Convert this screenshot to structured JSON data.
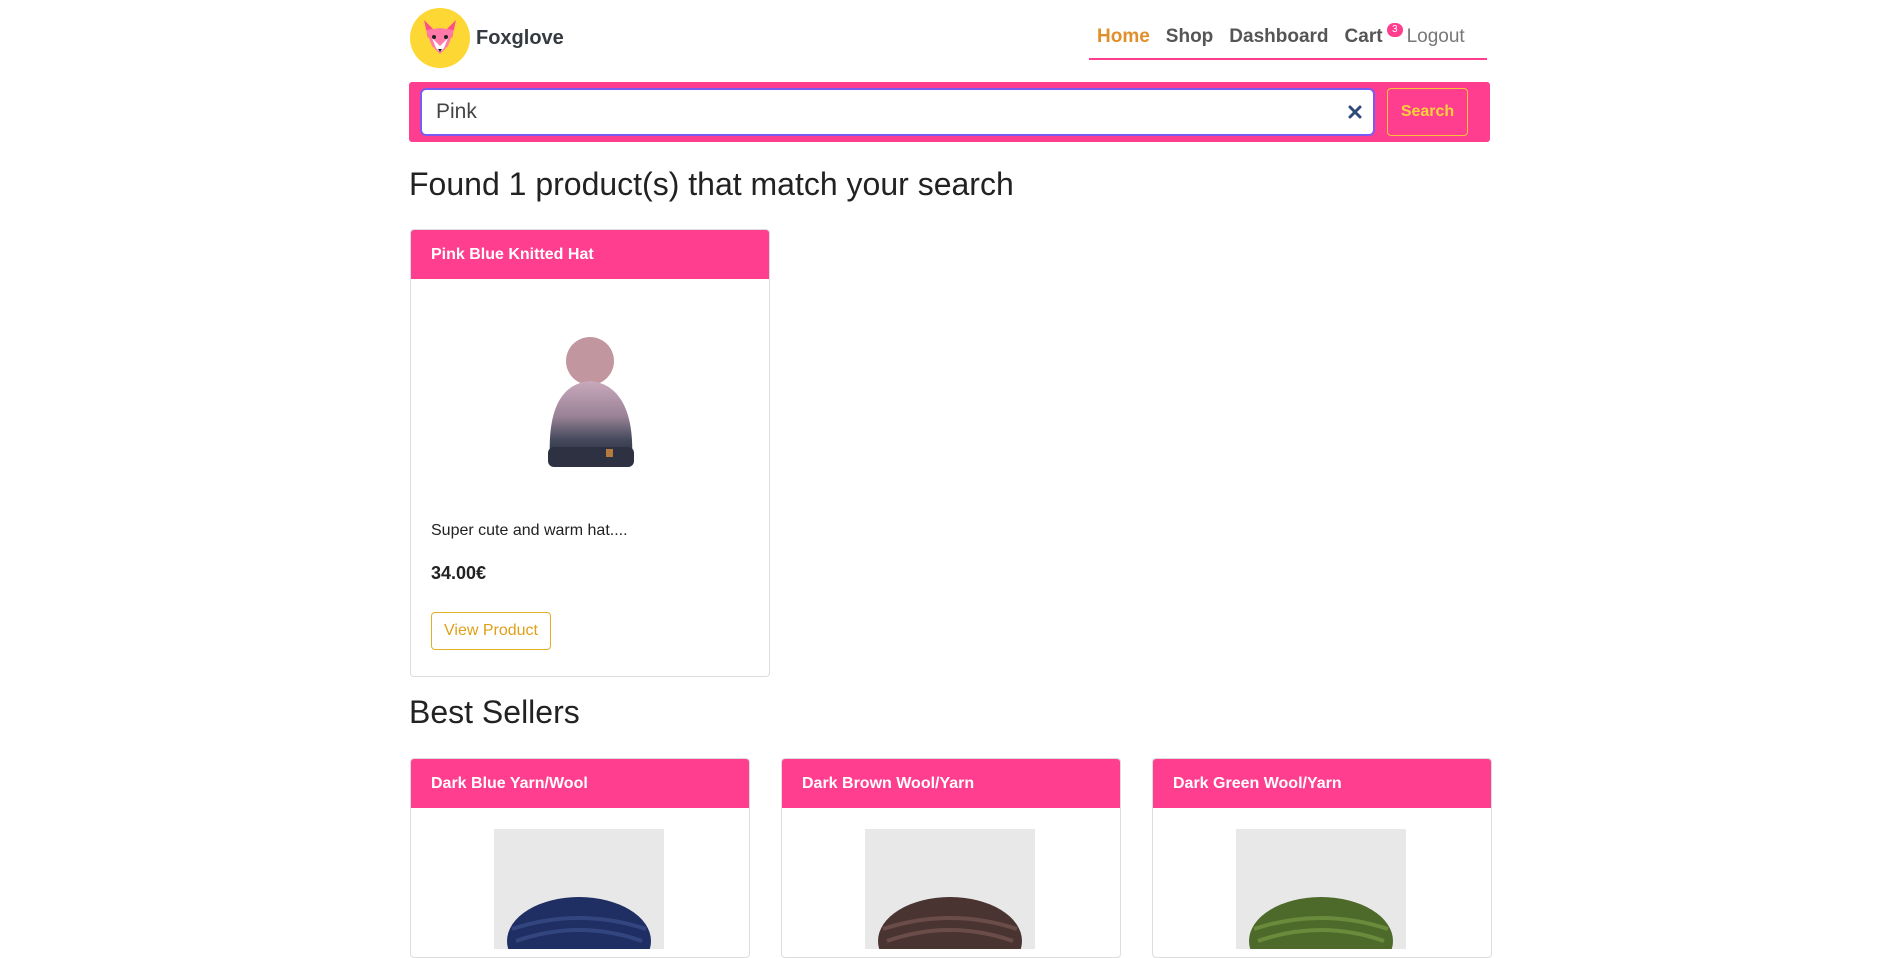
{
  "brand": {
    "name": "Foxglove",
    "logo_icon": "fox-icon"
  },
  "nav": {
    "items": [
      {
        "label": "Home",
        "active": true
      },
      {
        "label": "Shop"
      },
      {
        "label": "Dashboard"
      }
    ],
    "cart_label": "Cart",
    "cart_count": "3",
    "logout_label": "Logout"
  },
  "search": {
    "value": "Pink",
    "button_label": "Search",
    "clear_icon": "close-icon"
  },
  "results": {
    "heading": "Found 1 product(s) that match your search",
    "products": [
      {
        "name": "Pink Blue Knitted Hat",
        "description": "Super cute and warm hat....",
        "price": "34.00€",
        "button": "View Product"
      }
    ]
  },
  "best_sellers": {
    "heading": "Best Sellers",
    "products": [
      {
        "name": "Dark Blue Yarn/Wool",
        "color": "#1f2e63"
      },
      {
        "name": "Dark Brown Wool/Yarn",
        "color": "#4a3431"
      },
      {
        "name": "Dark Green Wool/Yarn",
        "color": "#4e6a2a"
      }
    ]
  },
  "colors": {
    "accent": "#ff3e8f",
    "active_nav": "#e0902a",
    "button_gold": "#f7d23a"
  }
}
